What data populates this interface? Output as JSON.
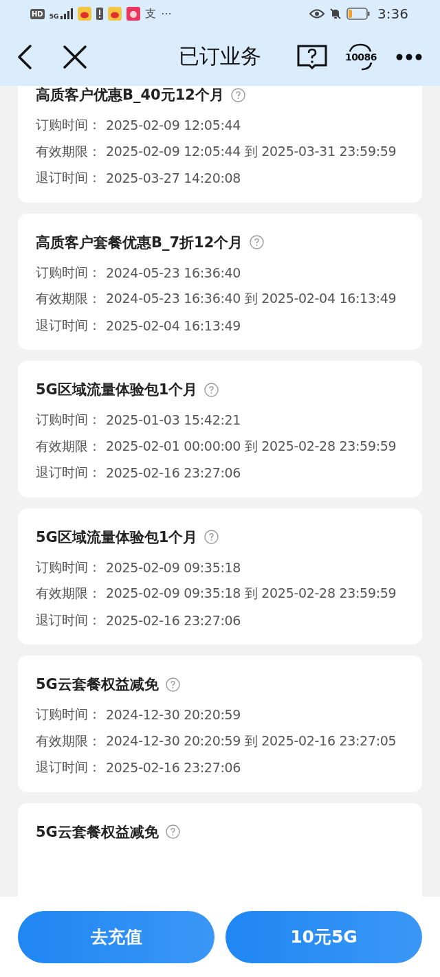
{
  "status_bar": {
    "network_badge": "HD",
    "network_type": "5G",
    "app_glyph": "支",
    "more": "···",
    "time": "3:36"
  },
  "nav": {
    "title": "已订业务",
    "hotline": "10086"
  },
  "cards": [
    {
      "title": "高质客户优惠B_40元12个月",
      "rows": [
        {
          "label": "订购时间：",
          "value": "2025-02-09 12:05:44"
        },
        {
          "label": "有效期限：",
          "value": "2025-02-09 12:05:44 到 2025-03-31 23:59:59"
        },
        {
          "label": "退订时间：",
          "value": "2025-03-27 14:20:08"
        }
      ]
    },
    {
      "title": "高质客户套餐优惠B_7折12个月",
      "rows": [
        {
          "label": "订购时间：",
          "value": "2024-05-23 16:36:40"
        },
        {
          "label": "有效期限：",
          "value": "2024-05-23 16:36:40 到 2025-02-04 16:13:49"
        },
        {
          "label": "退订时间：",
          "value": "2025-02-04 16:13:49"
        }
      ]
    },
    {
      "title": "5G区域流量体验包1个月",
      "rows": [
        {
          "label": "订购时间：",
          "value": "2025-01-03 15:42:21"
        },
        {
          "label": "有效期限：",
          "value": "2025-02-01 00:00:00 到 2025-02-28 23:59:59"
        },
        {
          "label": "退订时间：",
          "value": "2025-02-16 23:27:06"
        }
      ]
    },
    {
      "title": "5G区域流量体验包1个月",
      "rows": [
        {
          "label": "订购时间：",
          "value": "2025-02-09 09:35:18"
        },
        {
          "label": "有效期限：",
          "value": "2025-02-09 09:35:18 到 2025-02-28 23:59:59"
        },
        {
          "label": "退订时间：",
          "value": "2025-02-16 23:27:06"
        }
      ]
    },
    {
      "title": "5G云套餐权益减免",
      "rows": [
        {
          "label": "订购时间：",
          "value": "2024-12-30 20:20:59"
        },
        {
          "label": "有效期限：",
          "value": "2024-12-30 20:20:59 到 2025-02-16 23:27:05"
        },
        {
          "label": "退订时间：",
          "value": "2025-02-16 23:27:06"
        }
      ]
    },
    {
      "title": "5G云套餐权益减免"
    }
  ],
  "buttons": [
    "去充值",
    "10元5G"
  ]
}
